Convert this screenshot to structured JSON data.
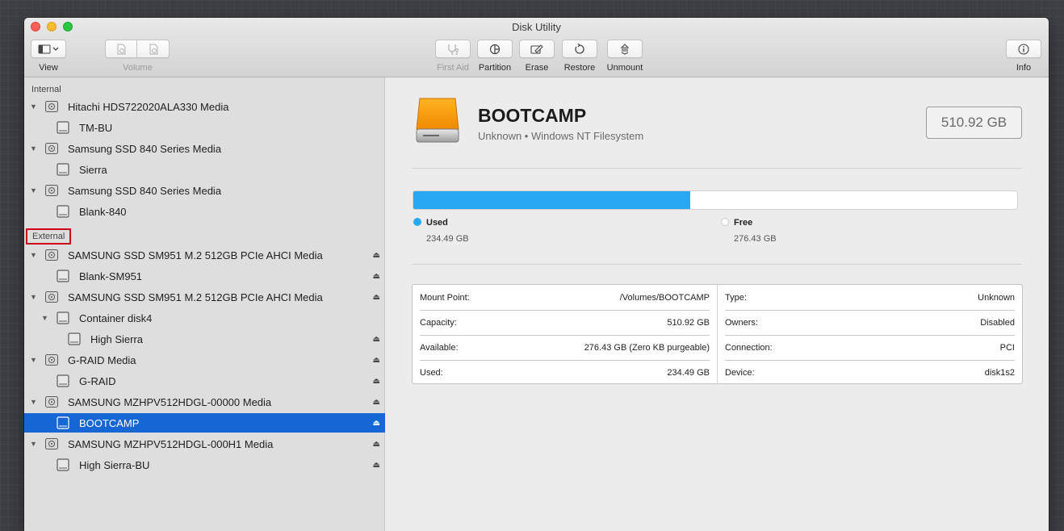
{
  "window": {
    "title": "Disk Utility"
  },
  "toolbar": {
    "view_label": "View",
    "volume_label": "Volume",
    "first_aid_label": "First Aid",
    "partition_label": "Partition",
    "erase_label": "Erase",
    "restore_label": "Restore",
    "unmount_label": "Unmount",
    "info_label": "Info"
  },
  "sidebar": {
    "internal_label": "Internal",
    "external_label": "External",
    "internal_items": [
      {
        "label": "Hitachi HDS722020ALA330 Media",
        "level": 0,
        "kind": "disk"
      },
      {
        "label": "TM-BU",
        "level": 1,
        "kind": "volume"
      },
      {
        "label": "Samsung SSD 840 Series Media",
        "level": 0,
        "kind": "disk"
      },
      {
        "label": "Sierra",
        "level": 1,
        "kind": "volume"
      },
      {
        "label": "Samsung SSD 840 Series Media",
        "level": 0,
        "kind": "disk"
      },
      {
        "label": "Blank-840",
        "level": 1,
        "kind": "volume"
      }
    ],
    "external_items": [
      {
        "label": "SAMSUNG SSD SM951 M.2 512GB PCIe AHCI Media",
        "level": 0,
        "kind": "disk",
        "eject": true
      },
      {
        "label": "Blank-SM951",
        "level": 1,
        "kind": "volume",
        "eject": true
      },
      {
        "label": "SAMSUNG SSD SM951 M.2 512GB PCIe AHCI Media",
        "level": 0,
        "kind": "disk",
        "eject": true
      },
      {
        "label": "Container disk4",
        "level": 1,
        "kind": "container",
        "eject": false
      },
      {
        "label": "High Sierra",
        "level": 2,
        "kind": "volume",
        "eject": true
      },
      {
        "label": "G-RAID Media",
        "level": 0,
        "kind": "disk",
        "eject": true
      },
      {
        "label": "G-RAID",
        "level": 1,
        "kind": "volume",
        "eject": true
      },
      {
        "label": "SAMSUNG MZHPV512HDGL-00000 Media",
        "level": 0,
        "kind": "disk",
        "eject": true
      },
      {
        "label": "BOOTCAMP",
        "level": 1,
        "kind": "volume",
        "eject": true,
        "selected": true
      },
      {
        "label": "SAMSUNG MZHPV512HDGL-000H1 Media",
        "level": 0,
        "kind": "disk",
        "eject": true
      },
      {
        "label": "High Sierra-BU",
        "level": 1,
        "kind": "volume",
        "eject": true
      }
    ]
  },
  "volume": {
    "name": "BOOTCAMP",
    "subtitle": "Unknown • Windows NT Filesystem",
    "size": "510.92 GB",
    "used_fraction": 0.459
  },
  "usage": {
    "used_label": "Used",
    "used_value": "234.49 GB",
    "free_label": "Free",
    "free_value": "276.43 GB",
    "used_color": "#28a8f3",
    "free_color": "#ffffff"
  },
  "details": {
    "left": [
      {
        "key": "Mount Point:",
        "value": "/Volumes/BOOTCAMP"
      },
      {
        "key": "Capacity:",
        "value": "510.92 GB"
      },
      {
        "key": "Available:",
        "value": "276.43 GB (Zero KB purgeable)"
      },
      {
        "key": "Used:",
        "value": "234.49 GB"
      }
    ],
    "right": [
      {
        "key": "Type:",
        "value": "Unknown"
      },
      {
        "key": "Owners:",
        "value": "Disabled"
      },
      {
        "key": "Connection:",
        "value": "PCI"
      },
      {
        "key": "Device:",
        "value": "disk1s2"
      }
    ]
  },
  "colors": {
    "selection": "#1766d6",
    "accent_red": "#d0021b"
  }
}
